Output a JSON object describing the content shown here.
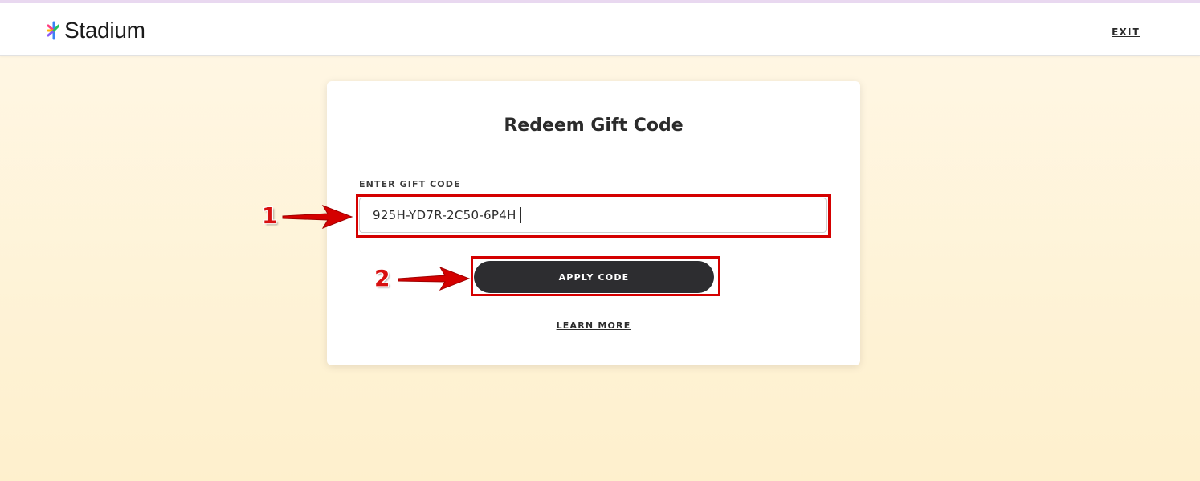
{
  "header": {
    "brand": "Stadium",
    "exit_label": "EXIT"
  },
  "card": {
    "title": "Redeem Gift Code",
    "field_label": "ENTER GIFT CODE",
    "code_value": "925H-YD7R-2C50-6P4H",
    "apply_label": "APPLY CODE",
    "learn_more_label": "LEARN MORE"
  },
  "annotations": {
    "step1": "1",
    "step2": "2",
    "color": "#d40000"
  },
  "colors": {
    "button_bg": "#2d2d30",
    "logo_colors": [
      "#ff3d7f",
      "#ffb400",
      "#22c55e",
      "#3b82f6",
      "#8b5cf6"
    ]
  }
}
